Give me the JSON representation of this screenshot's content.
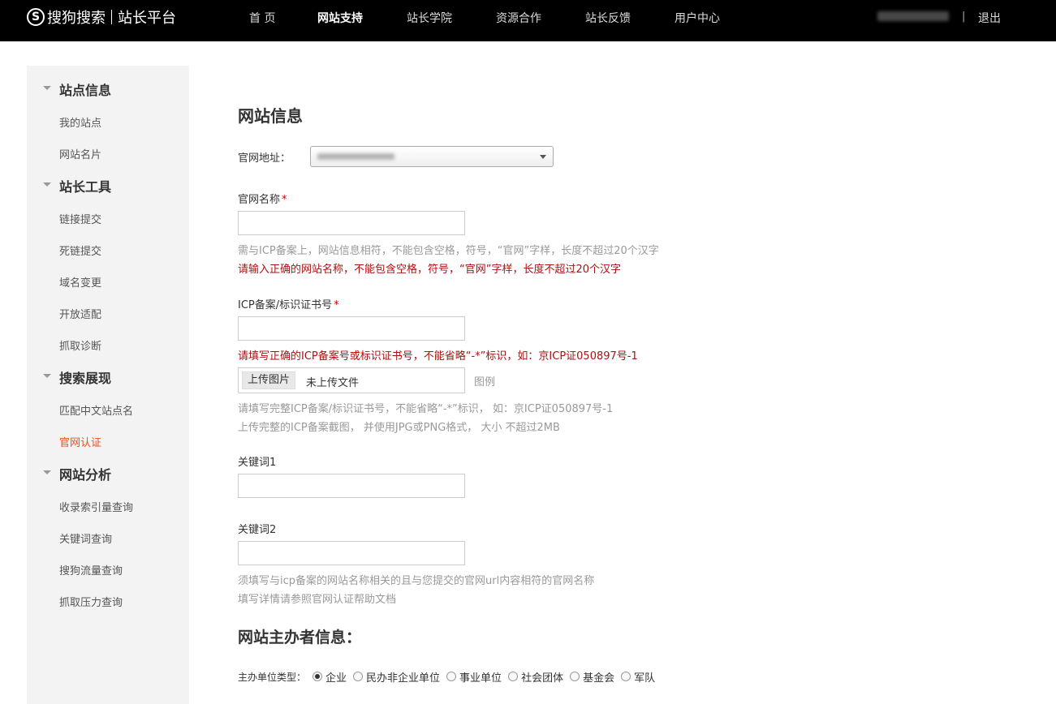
{
  "header": {
    "logo_mark": "S",
    "brand": "搜狗搜索",
    "platform": "站长平台",
    "nav": [
      {
        "label": "首 页",
        "active": false
      },
      {
        "label": "网站支持",
        "active": true
      },
      {
        "label": "站长学院",
        "active": false
      },
      {
        "label": "资源合作",
        "active": false
      },
      {
        "label": "站长反馈",
        "active": false
      },
      {
        "label": "用户中心",
        "active": false
      }
    ],
    "separator": "|",
    "logout": "退出"
  },
  "sidebar": {
    "groups": [
      {
        "label": "站点信息",
        "items": [
          "我的站点",
          "网站名片"
        ]
      },
      {
        "label": "站长工具",
        "items": [
          "链接提交",
          "死链提交",
          "域名变更",
          "开放适配",
          "抓取诊断"
        ]
      },
      {
        "label": "搜索展现",
        "items": [
          "匹配中文站点名",
          "官网认证"
        ]
      },
      {
        "label": "网站分析",
        "items": [
          "收录索引量查询",
          "关键词查询",
          "搜狗流量查询",
          "抓取压力查询"
        ]
      }
    ],
    "active_item": "官网认证"
  },
  "form": {
    "title": "网站信息",
    "site_url_label": "官网地址：",
    "site_name_label": "官网名称",
    "required_mark": "*",
    "site_name_hint": "需与ICP备案上，网站信息相符，不能包含空格，符号，“官网”字样，长度不超过20个汉字",
    "site_name_error": "请输入正确的网站名称，不能包含空格，符号，“官网”字样，长度不超过20个汉字",
    "icp_label": "ICP备案/标识证书号",
    "icp_error": "请填写正确的ICP备案号或标识证书号，不能省略“-*”标识，如：京ICP证050897号-1",
    "upload_button": "上传图片",
    "upload_status": "未上传文件",
    "example_link": "图例",
    "icp_hint_1": "请填写完整ICP备案/标识证书号，不能省略“-*”标识， 如：京ICP证050897号-1",
    "icp_hint_2": "上传完整的ICP备案截图， 并使用JPG或PNG格式， 大小 不超过2MB",
    "keyword1_label": "关键词1",
    "keyword2_label": "关键词2",
    "keyword_hint_1": "须填写与icp备案的网站名称相关的且与您提交的官网url内容相符的官网名称",
    "keyword_hint_2": "填写详情请参照官网认证帮助文档",
    "owner_section_title": "网站主办者信息：",
    "org_type_label": "主办单位类型：",
    "org_types": [
      "企业",
      "民办非企业单位",
      "事业单位",
      "社会团体",
      "基金会",
      "军队"
    ],
    "org_type_selected": "企业"
  }
}
